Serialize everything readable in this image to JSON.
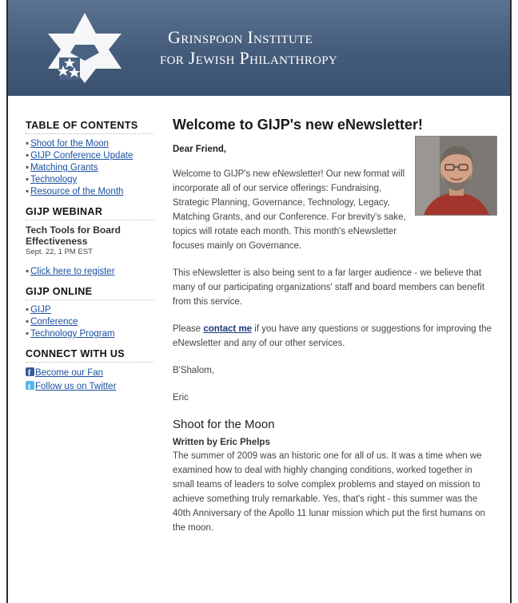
{
  "header": {
    "title_line1": "Grinspoon Institute",
    "title_line2": "for Jewish Philanthropy"
  },
  "sidebar": {
    "toc_heading": "TABLE OF CONTENTS",
    "toc_items": [
      "Shoot for the Moon",
      "GIJP Conference Update",
      "Matching Grants",
      "Technology",
      "Resource of the Month"
    ],
    "webinar_heading": "GIJP WEBINAR",
    "webinar_title": "Tech Tools for Board Effectiveness",
    "webinar_date": "Sept. 22, 1 PM EST",
    "register_link": "Click here to register",
    "online_heading": "GIJP ONLINE",
    "online_items": [
      "GIJP",
      "Conference",
      "Technology Program"
    ],
    "connect_heading": "CONNECT WITH US",
    "fan_link": "Become our Fan",
    "twitter_link": "Follow us on Twitter"
  },
  "main": {
    "headline": "Welcome to GIJP's new eNewsletter!",
    "greeting": "Dear Friend,",
    "para1": "Welcome to GIJP's new eNewsletter! Our new format will incorporate all of our service offerings: Fundraising, Strategic Planning, Governance, Technology, Legacy, Matching Grants, and our Conference. For brevity's sake, topics will rotate each month. This month's eNewsletter focuses mainly on Governance.",
    "para2": "This eNewsletter is also being sent to a far larger audience - we believe that many of our participating organizations' staff and board members can benefit from this service.",
    "para3_pre": "Please ",
    "para3_link": "contact me",
    "para3_post": " if you have any questions or suggestions for improving the eNewsletter and any of our other services.",
    "signoff": "B'Shalom,",
    "signature": "Eric",
    "section_title": "Shoot for the Moon",
    "byline": "Written by Eric Phelps",
    "section_body": "The summer of 2009 was an historic one for all of us.  It was a time when we examined how to deal with highly changing conditions, worked together in small teams of leaders to solve complex problems and stayed on mission to achieve something truly remarkable.  Yes, that's right - this summer was the 40th Anniversary of the Apollo 11 lunar mission which put the first humans on the moon."
  },
  "icons": {
    "logo": "star-of-david-logo-icon",
    "facebook": "facebook-icon",
    "twitter": "twitter-icon"
  },
  "colors": {
    "header_bg": "#445b7a",
    "link": "#1a4fa0"
  }
}
